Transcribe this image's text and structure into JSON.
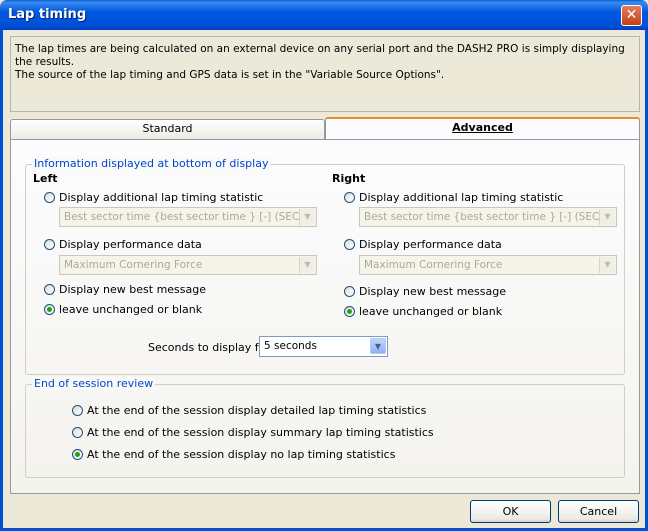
{
  "window": {
    "title": "Lap timing",
    "close_glyph": "✕"
  },
  "info": {
    "line1": "The lap times are being calculated on an external device on any serial port and the DASH2 PRO is simply displaying the results.",
    "line2": "The source of the lap timing and GPS data is set in the \"Variable Source Options\"."
  },
  "tabs": [
    {
      "label": "Standard",
      "active": false
    },
    {
      "label": "Advanced",
      "active": true
    }
  ],
  "info_group": {
    "label": "Information displayed at bottom of display",
    "left": {
      "heading": "Left",
      "opt_stat": "Display additional lap timing statistic",
      "stat_combo": "Best sector time  {best sector time } [-] (SEC T)",
      "opt_perf": "Display performance data",
      "perf_combo": "Maximum Cornering Force",
      "opt_best": "Display new best message",
      "opt_leave": "leave unchanged or blank",
      "selected": "leave"
    },
    "right": {
      "heading": "Right",
      "opt_stat": "Display additional lap timing statistic",
      "stat_combo": "Best sector time  {best sector time } [-] (SEC T)",
      "opt_perf": "Display performance data",
      "perf_combo": "Maximum Cornering Force",
      "opt_best": "Display new best message",
      "opt_leave": "leave unchanged or blank",
      "selected": "leave"
    },
    "seconds_label": "Seconds to display for:",
    "seconds_value": "5 seconds"
  },
  "session_group": {
    "label": "End of session review",
    "opt_detailed": "At the end of the session display detailed lap timing statistics",
    "opt_summary": "At the end of the session display summary lap timing statistics",
    "opt_none": "At the end of the session display no lap timing statistics",
    "selected": "none"
  },
  "buttons": {
    "ok": "OK",
    "cancel": "Cancel"
  },
  "icons": {
    "dropdown": "▼"
  }
}
